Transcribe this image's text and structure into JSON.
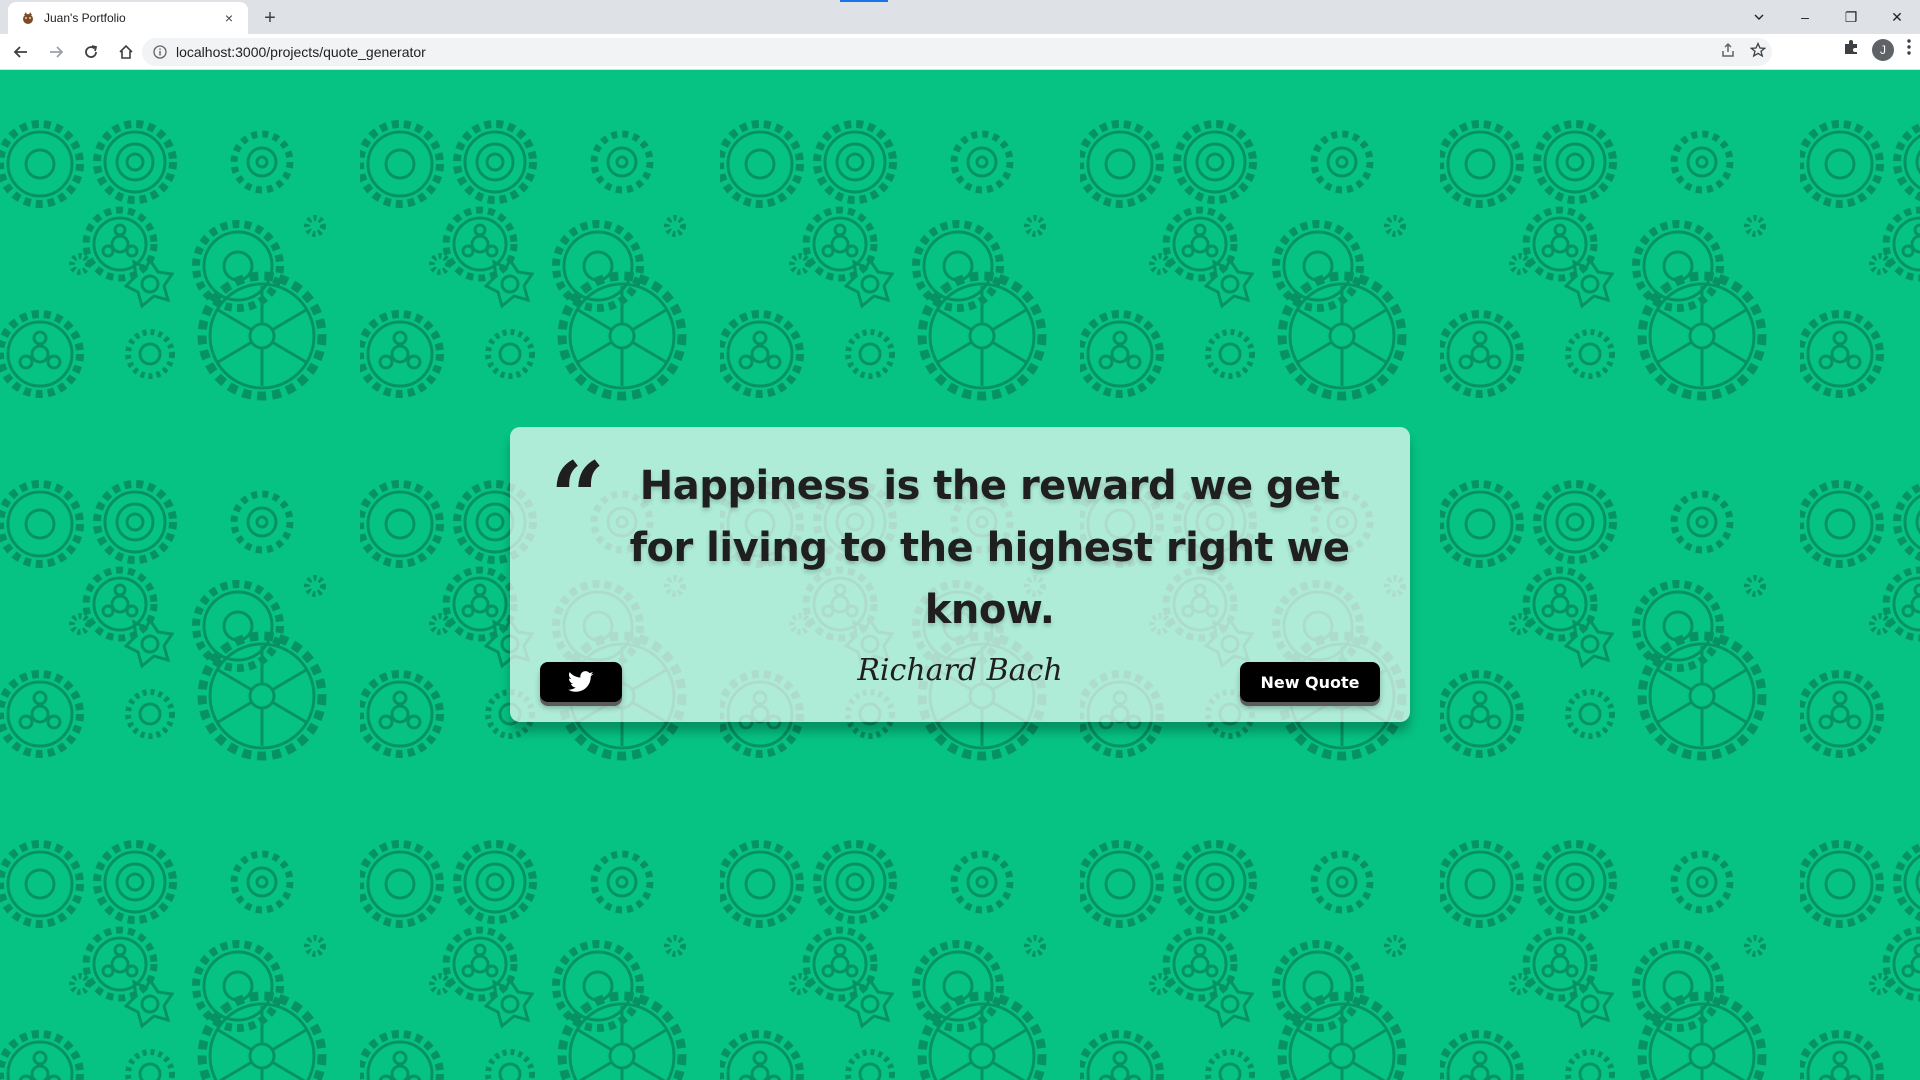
{
  "browser": {
    "tab_title": "Juan's Portfolio",
    "tab_close_glyph": "×",
    "new_tab_glyph": "+",
    "url": "localhost:3000/projects/quote_generator",
    "profile_initial": "J",
    "window_controls": {
      "minimize": "–",
      "restore": "❐",
      "close": "✕"
    }
  },
  "page": {
    "background_color": "#06c383",
    "pattern_color": "#058a5c"
  },
  "quote": {
    "mark_glyph": "“",
    "text": "Happiness is the reward we get for living to the highest right we know.",
    "author": "Richard Bach"
  },
  "buttons": {
    "twitter_icon": "twitter-icon",
    "new_quote_label": "New Quote"
  }
}
